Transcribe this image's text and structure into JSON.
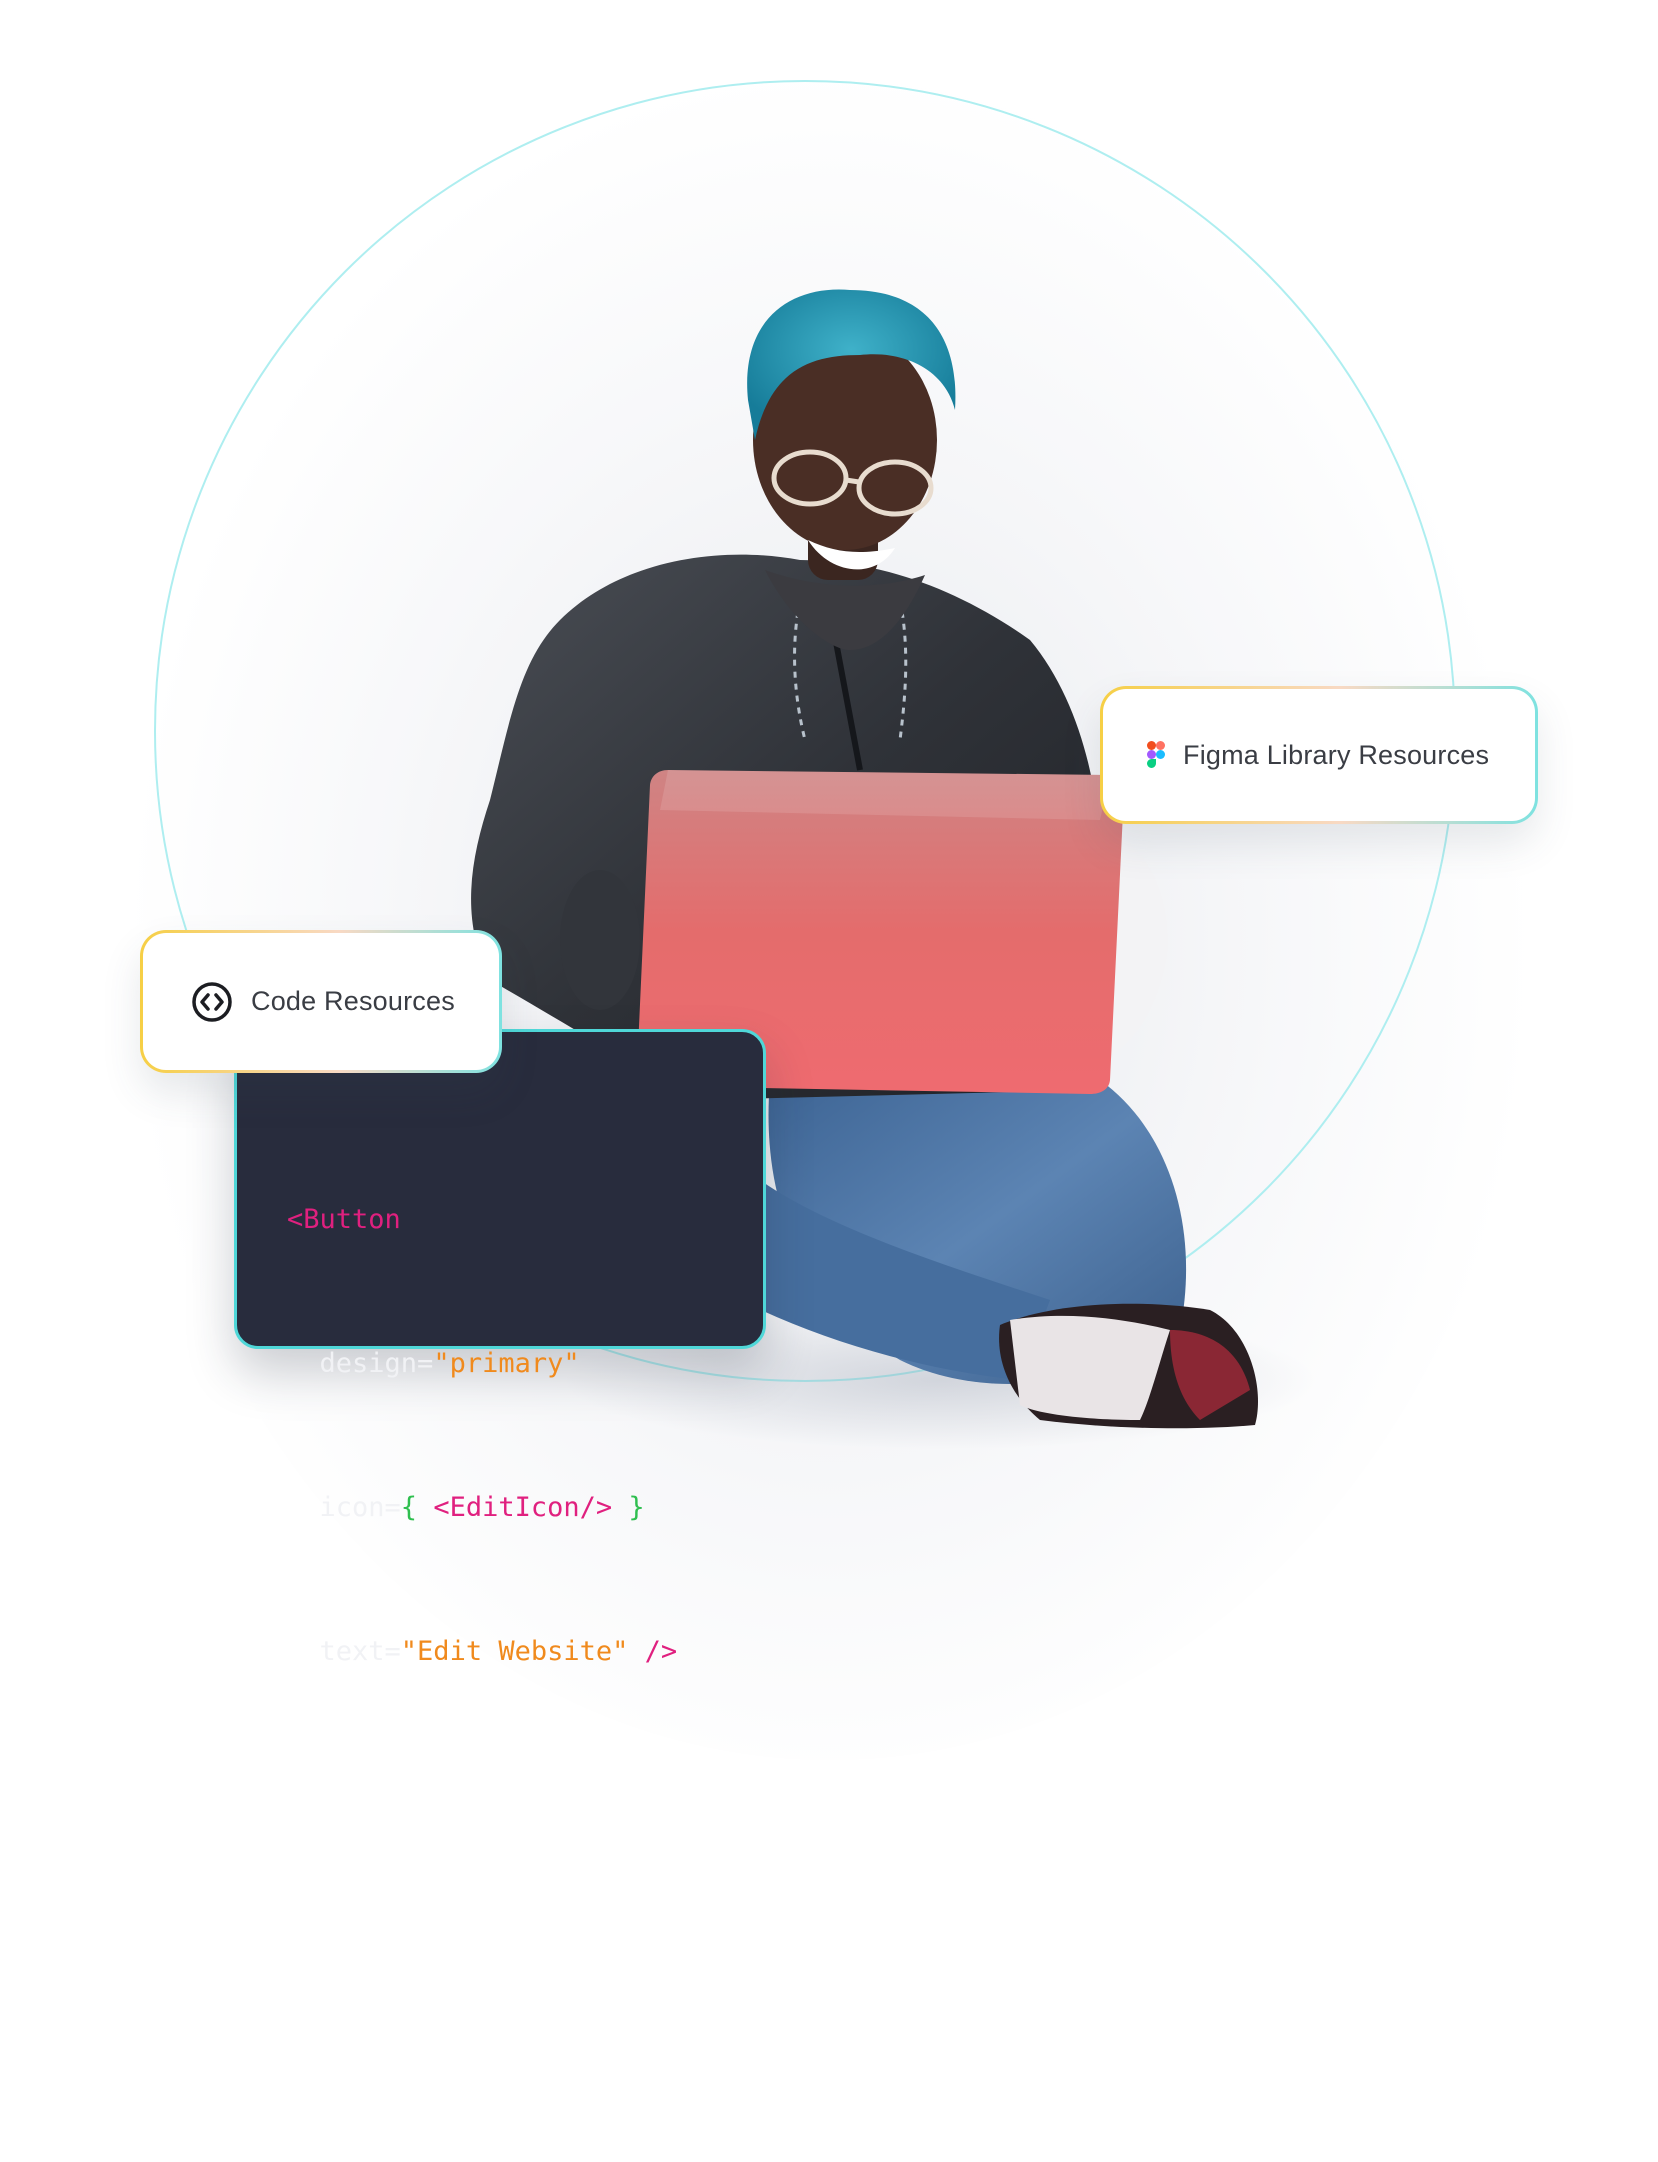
{
  "badges": {
    "figma": {
      "label": "Figma Library Resources",
      "icon": "figma-logo-icon"
    },
    "code": {
      "label": "Code Resources",
      "icon": "code-brackets-icon"
    }
  },
  "code_snippet": {
    "line1": {
      "tag": "<Button"
    },
    "line2": {
      "attr": "design=",
      "value": "\"primary\""
    },
    "line3": {
      "attr": "icon=",
      "open": "{",
      "tag": "<EditIcon/>",
      "close": "}"
    },
    "line4": {
      "attr": "text=",
      "value": "\"Edit Website\"",
      "tag": "/>"
    }
  },
  "colors": {
    "ring": "#aeeef0",
    "code_bg": "#282c3d",
    "code_border": "#4fd7d8",
    "tag": "#e0207f",
    "string": "#f08a1d",
    "brace": "#2fbf4f",
    "badge_border_start": "#f6cf45",
    "badge_border_end": "#7ee2e0"
  }
}
